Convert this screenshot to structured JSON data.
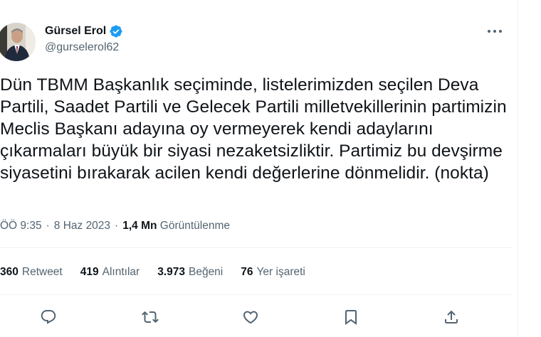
{
  "author": {
    "display_name": "Gürsel Erol",
    "handle": "@gurselerol62",
    "verified": true
  },
  "tweet": {
    "text": "Dün TBMM Başkanlık seçiminde, listelerimizden seçilen Deva Partili, Saadet Partili ve Gelecek Partili milletvekillerinin partimizin Meclis Başkanı adayına oy vermeyerek kendi adaylarını çıkarmaları büyük bir siyasi nezaketsizliktir. Partimiz bu devşirme siyasetini bırakarak acilen kendi değerlerine dönmelidir. (nokta)"
  },
  "meta": {
    "time": "ÖÖ 9:35",
    "separator": "·",
    "date": "8 Haz 2023",
    "views_count": "1,4 Mn",
    "views_label": "Görüntülenme"
  },
  "stats": [
    {
      "count": "360",
      "label": "Retweet"
    },
    {
      "count": "419",
      "label": "Alıntılar"
    },
    {
      "count": "3.973",
      "label": "Beğeni"
    },
    {
      "count": "76",
      "label": "Yer işareti"
    }
  ],
  "actions": [
    "reply-icon",
    "retweet-icon",
    "like-icon",
    "bookmark-icon",
    "share-icon"
  ],
  "colors": {
    "text": "#0f1419",
    "secondary": "#536471",
    "verified": "#1d9bf0",
    "divider": "#eff3f4"
  }
}
